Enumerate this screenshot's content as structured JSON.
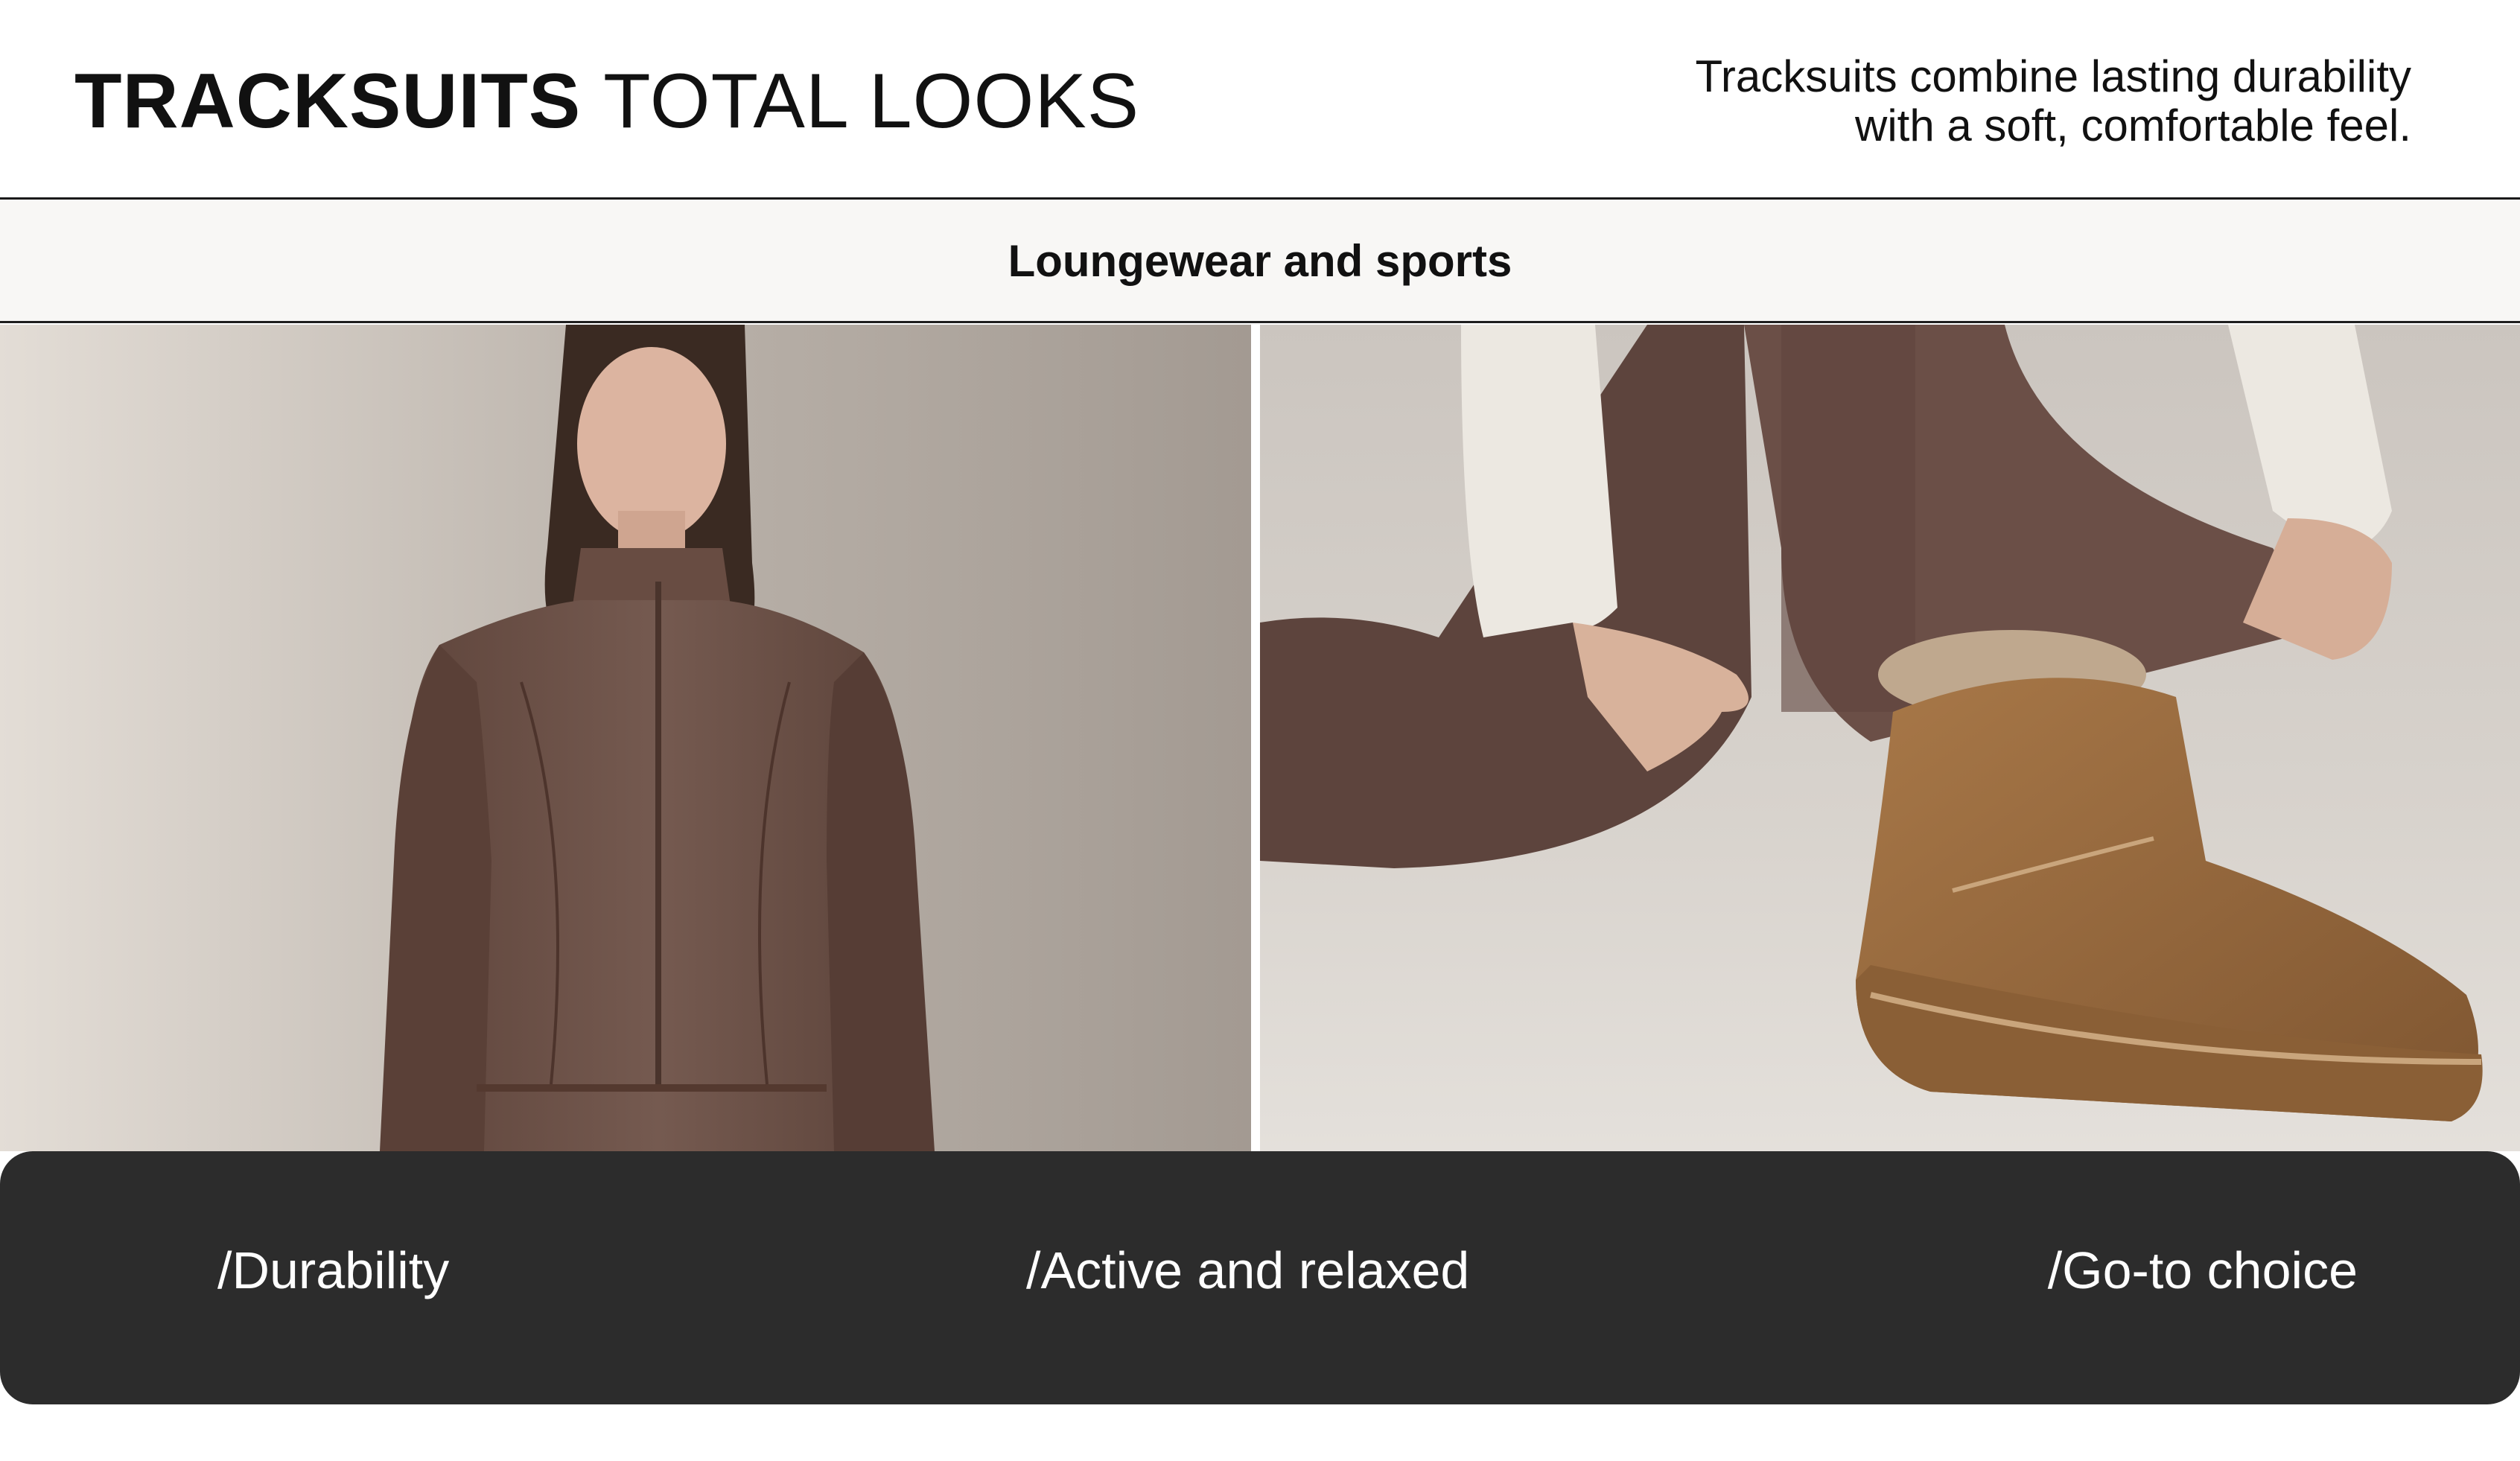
{
  "header": {
    "title_bold": "TRACKSUITS",
    "title_light": "TOTAL LOOKS",
    "tagline_line1": "Tracksuits combine lasting durability",
    "tagline_line2": "with a soft, comfortable feel."
  },
  "section": {
    "label": "Loungewear and sports"
  },
  "images": {
    "left": "woman-in-brown-zip-tracksuit-jacket-photo",
    "right": "hands-lifting-brown-trouser-hem-over-suede-boot-photo"
  },
  "features": [
    {
      "label": "/Durability"
    },
    {
      "label": "/Active and relaxed"
    },
    {
      "label": "/Go-to choice"
    }
  ],
  "colors": {
    "background": "#ffffff",
    "band": "#f8f7f5",
    "features_bar": "#2c2c2c",
    "tracksuit_brown": "#6e5046",
    "boot_tan": "#9a6d43"
  }
}
